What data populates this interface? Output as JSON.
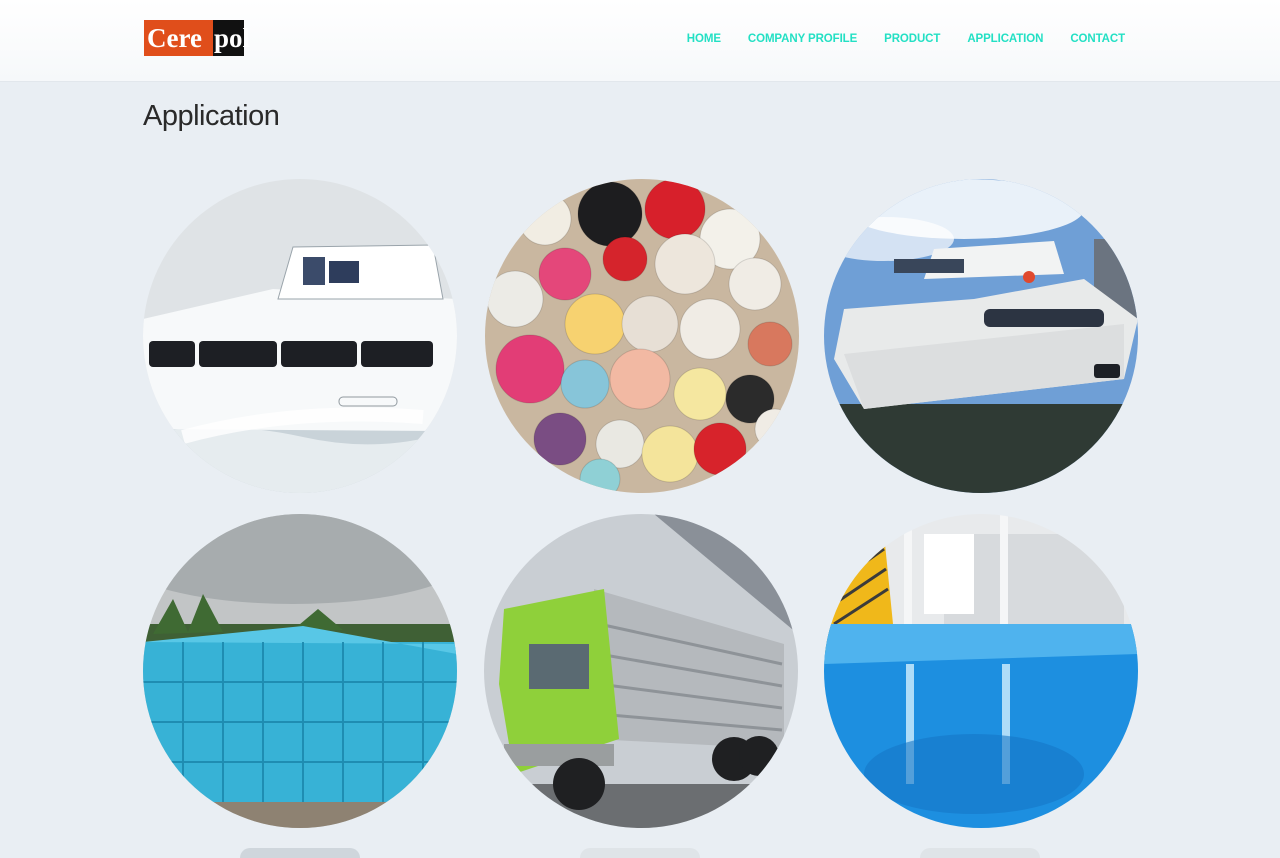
{
  "header": {
    "logo_text_left": "Cere",
    "logo_text_right": "pol",
    "nav": [
      "HOME",
      "COMPANY PROFILE",
      "PRODUCT",
      "APPLICATION",
      "CONTACT"
    ]
  },
  "page": {
    "title": "Application"
  },
  "colors": {
    "accent": "#23e0c4",
    "logo_orange": "#e04e1b",
    "logo_black": "#111111",
    "background": "#e9eef3"
  },
  "gallery": [
    {
      "image": "speedboat"
    },
    {
      "image": "colorful-buttons"
    },
    {
      "image": "luxury-yacht"
    },
    {
      "image": "blue-water-tank"
    },
    {
      "image": "green-truck"
    },
    {
      "image": "blue-epoxy-floor"
    }
  ]
}
